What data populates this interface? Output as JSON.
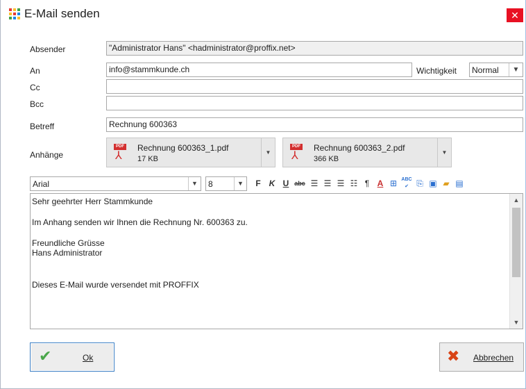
{
  "window": {
    "title": "E-Mail senden",
    "close_symbol": "✕"
  },
  "form": {
    "sender_label": "Absender",
    "sender_value": "\"Administrator Hans\" <hadministrator@proffix.net>",
    "to_label": "An",
    "to_value": "info@stammkunde.ch",
    "priority_label": "Wichtigkeit",
    "priority_value": "Normal",
    "cc_label": "Cc",
    "cc_value": "",
    "bcc_label": "Bcc",
    "bcc_value": "",
    "subject_label": "Betreff",
    "subject_value": "Rechnung 600363",
    "attachments_label": "Anhänge"
  },
  "attachments": [
    {
      "name": "Rechnung 600363_1.pdf",
      "size": "17 KB",
      "badge": "PDF"
    },
    {
      "name": "Rechnung 600363_2.pdf",
      "size": "366 KB",
      "badge": "PDF"
    }
  ],
  "toolbar": {
    "font": "Arial",
    "font_size": "8",
    "bold": "F",
    "italic": "K",
    "underline": "U",
    "strike": "abc",
    "paragraph": "¶",
    "font_color": "A",
    "spell_badge": "ABC"
  },
  "body_lines": [
    "Sehr geehrter Herr Stammkunde",
    "Im Anhang senden wir Ihnen die Rechnung Nr. 600363 zu.",
    "Freundliche Grüsse",
    "Hans Administrator",
    "Dieses E-Mail wurde versendet mit PROFFIX"
  ],
  "buttons": {
    "ok_label": "Ok",
    "cancel_label": "Abbrechen"
  },
  "colors": {
    "close": "#e81123",
    "ok_check": "#4aa64a",
    "cancel_x": "#d84315",
    "pdf_red": "#d32f2f"
  }
}
